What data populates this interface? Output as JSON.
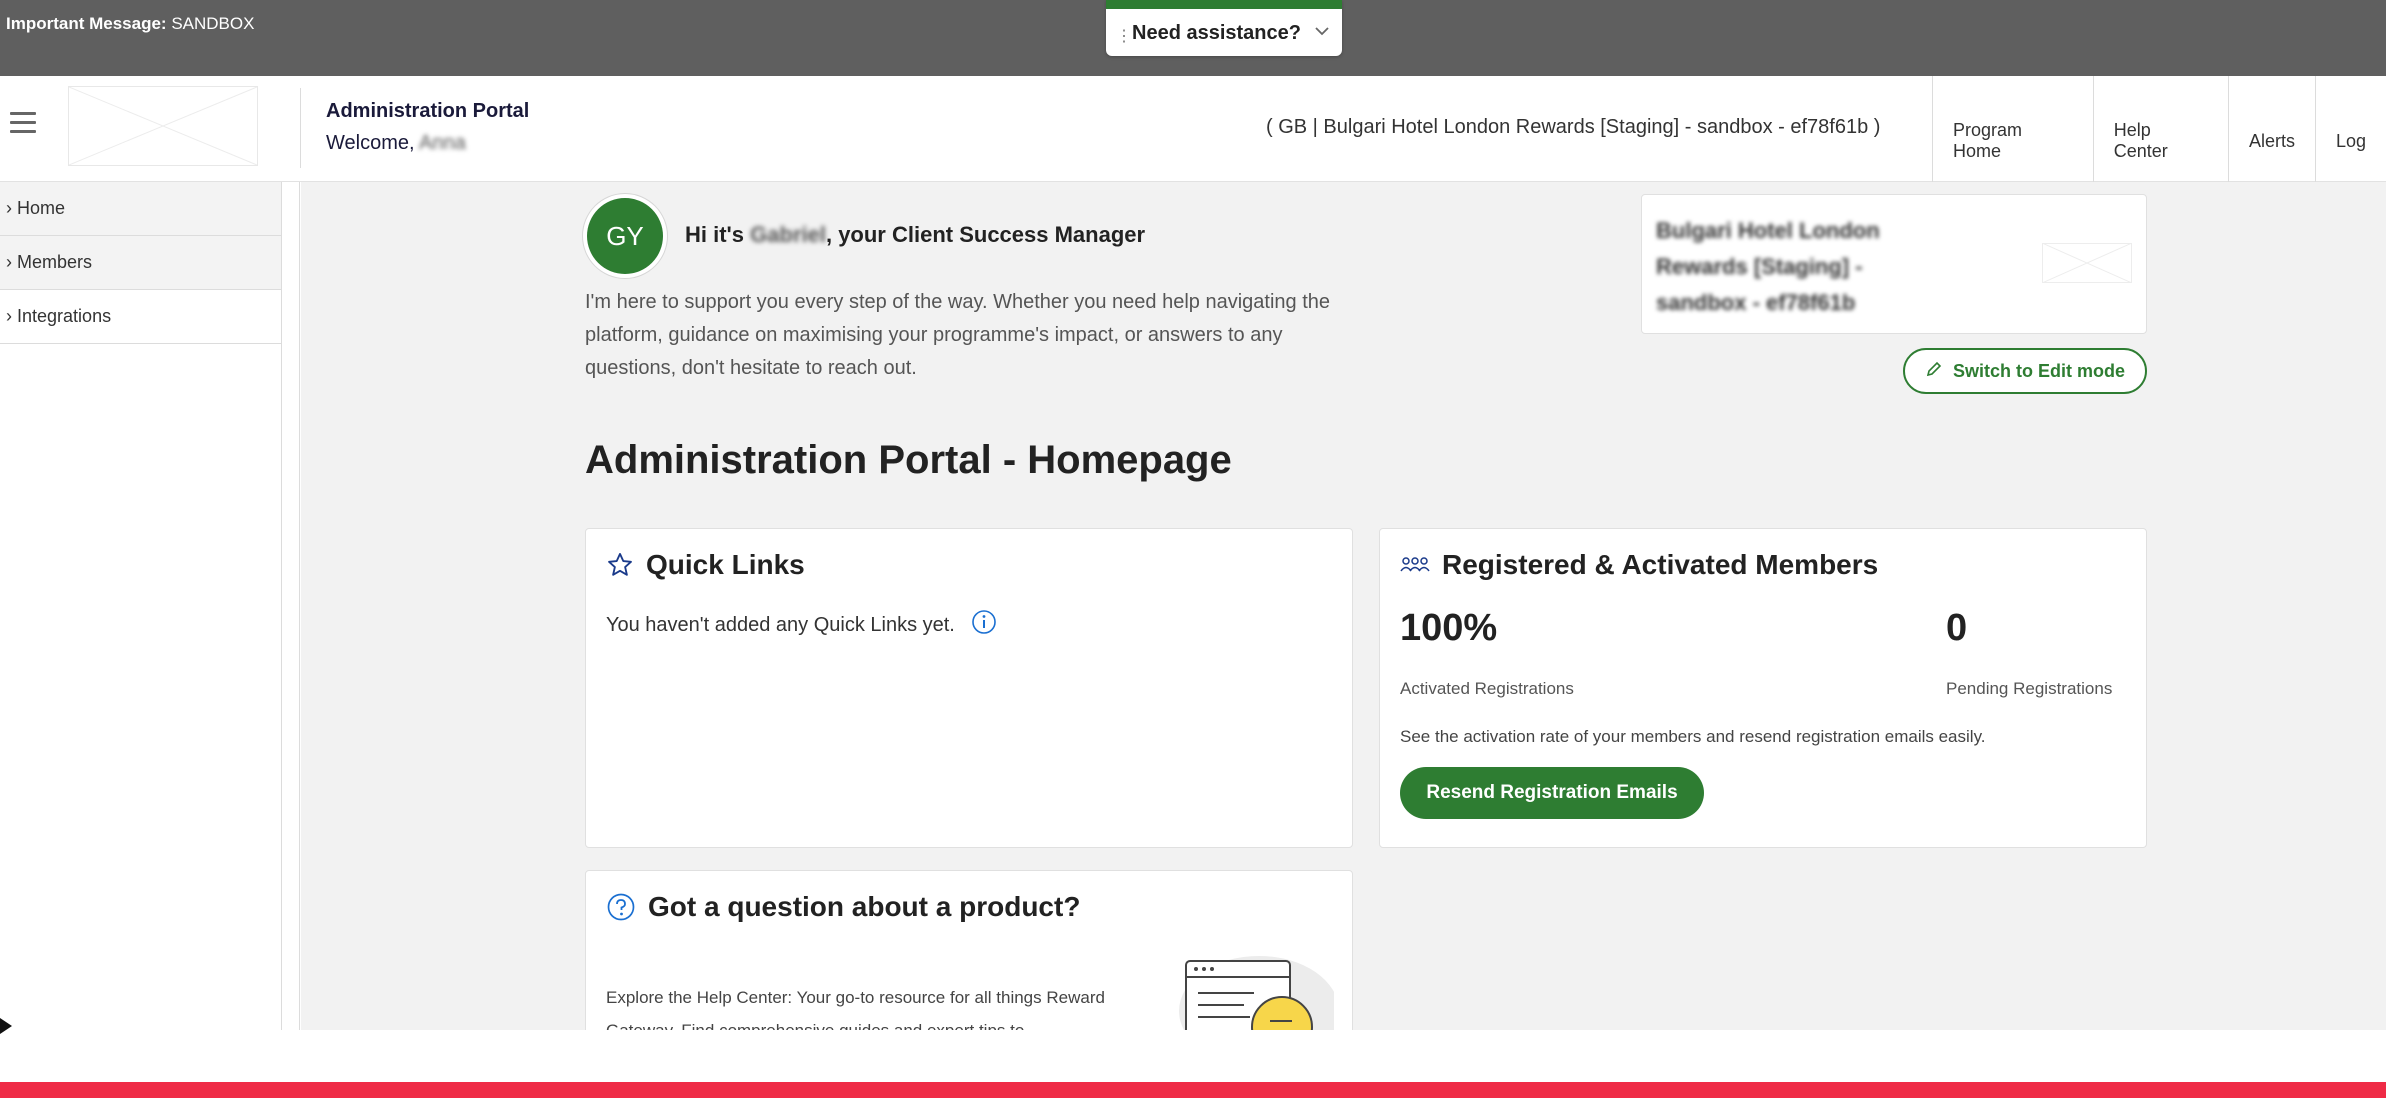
{
  "system_bar": {
    "message_label": "Important Message:",
    "message_value": "SANDBOX"
  },
  "assistance": {
    "label": "Need assistance?",
    "accent_color": "#2e7d32"
  },
  "header": {
    "portal_title": "Administration Portal",
    "welcome_prefix": "Welcome,",
    "welcome_name": "Anna",
    "program_info": "( GB | Bulgari Hotel London Rewards [Staging] - sandbox - ef78f61b )",
    "nav": [
      "Program Home",
      "Help Center",
      "Alerts",
      "Log"
    ]
  },
  "sidebar": {
    "items": [
      {
        "label": "Home"
      },
      {
        "label": "Members"
      },
      {
        "label": "Integrations"
      }
    ]
  },
  "csm": {
    "initials": "GY",
    "title_prefix": "Hi it's",
    "name": "Gabriel",
    "title_suffix": ", your Client Success Manager",
    "description": "I'm here to support you every step of the way. Whether you need help navigating the platform, guidance on maximising your programme's impact, or answers to any questions, don't hesitate to reach out."
  },
  "brand_card": {
    "name": "Bulgari Hotel London Rewards [Staging] - sandbox - ef78f61b"
  },
  "edit_mode_button": "Switch to Edit mode",
  "page_title": "Administration Portal - Homepage",
  "quick_links": {
    "title": "Quick Links",
    "empty_text": "You haven't added any Quick Links yet."
  },
  "registered": {
    "title": "Registered & Activated Members",
    "activated_value": "100%",
    "activated_label": "Activated Registrations",
    "pending_value": "0",
    "pending_label": "Pending Registrations",
    "description": "See the activation rate of your members and resend registration emails easily.",
    "button": "Resend Registration Emails"
  },
  "product_question": {
    "title": "Got a question about a product?",
    "description": "Explore the Help Center: Your go-to resource for all things Reward Gateway. Find comprehensive guides and expert tips to"
  },
  "colors": {
    "primary_green": "#2e7d32",
    "system_bar": "#5f5f5f",
    "bottom_bar": "#ef2b46",
    "info_blue": "#1a6fd1"
  }
}
